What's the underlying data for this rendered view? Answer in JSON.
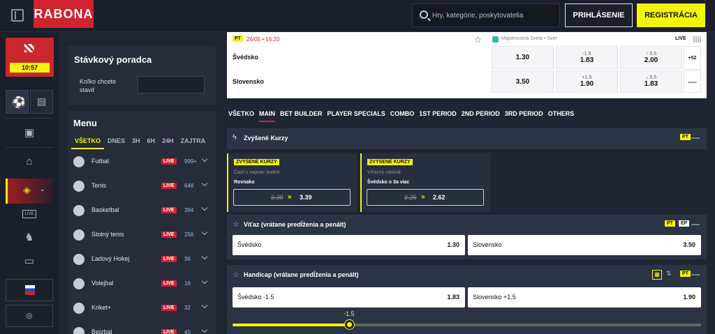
{
  "header": {
    "logo": "RABONA",
    "search_placeholder": "Hry, kategórie, poskytovatelia",
    "login_label": "PRIHLÁSENIE",
    "register_label": "REGISTRÁCIA"
  },
  "rail": {
    "promo_timer": "10:57"
  },
  "advisor": {
    "title": "Stávkový poradca",
    "question": "Koľko chcete staviť"
  },
  "menu": {
    "title": "Menu",
    "tabs": [
      "VŠETKO",
      "DNES",
      "3H",
      "6H",
      "24H",
      "ZAJTRA"
    ],
    "live_label": "LIVE",
    "sports": [
      {
        "name": "Futbal",
        "count": "999+"
      },
      {
        "name": "Tenis",
        "count": "648"
      },
      {
        "name": "Basketbal",
        "count": "394"
      },
      {
        "name": "Stolný tenis",
        "count": "258"
      },
      {
        "name": "Ľadový Hokej",
        "count": "36"
      },
      {
        "name": "Volejbal",
        "count": "16"
      },
      {
        "name": "Kriket+",
        "count": "32"
      },
      {
        "name": "Bejzbal",
        "count": "40"
      }
    ]
  },
  "match": {
    "pt_badge": "PT",
    "datetime": "26/05 • 16:20",
    "league": "Majstrovstvá Sveta • Svet",
    "live_label": "LIVE",
    "more_count": "+52",
    "collapse_symbol": "—",
    "team_home": "Švédsko",
    "team_away": "Slovensko",
    "home_win": "1.30",
    "home_handicap_line": "-1.5",
    "home_handicap_odd": "1.83",
    "over_line": "↑ 5.5",
    "over_odd": "2.00",
    "away_win": "3.50",
    "away_handicap_line": "+1.5",
    "away_handicap_odd": "1.90",
    "under_line": "↓ 5.5",
    "under_odd": "1.83"
  },
  "market_tabs": [
    "VŠETKO",
    "MAIN",
    "BET BUILDER",
    "PLAYER SPECIALS",
    "COMBO",
    "1ST PERIOD",
    "2ND PERIOD",
    "3RD PERIOD",
    "OTHERS"
  ],
  "boosted": {
    "title": "Zvýšené Kurzy",
    "badge": "PT",
    "cards": [
      {
        "tag": "ZVÝŠENÉ KURZY",
        "desc": "Časť s najviac bodmi",
        "selection": "Rovnako",
        "old": "3.30",
        "arrow": "»",
        "new": "3.39"
      },
      {
        "tag": "ZVÝŠENÉ KURZY",
        "desc": "Víťazný náskok",
        "selection": "Švédsko o 3a viac",
        "old": "2.25",
        "arrow": "»",
        "new": "2.62"
      }
    ]
  },
  "winner": {
    "title": "Víťaz (vrátane predĺženia a penált)",
    "badge_pt": "PT",
    "badge_ep": "EP",
    "home_label": "Švédsko",
    "home_odd": "1.30",
    "away_label": "Slovensko",
    "away_odd": "3.50"
  },
  "handicap": {
    "title": "Handicap (vrátane predĺženia a penált)",
    "badge_pt": "PT",
    "home_label": "Švédsko -1.5",
    "home_odd": "1.83",
    "away_label": "Slovensko +1.5",
    "away_odd": "1.90",
    "slider_value": "-1.5"
  }
}
